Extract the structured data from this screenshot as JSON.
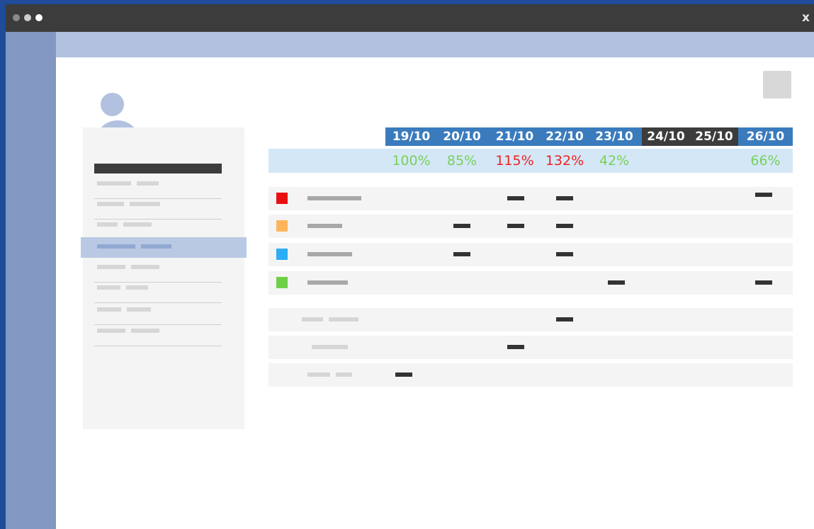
{
  "window": {
    "close_label": "x"
  },
  "colors": {
    "accent": "#3a7bbd",
    "header_dark": "#3c3c3c",
    "ok": "#77d05c",
    "over": "#ee2222",
    "sidebar_selected": "#b9c9e4"
  },
  "user": {
    "avatar_icon": "person-icon"
  },
  "calendar": {
    "days": [
      {
        "label": "19/10",
        "load": "100%",
        "status": "ok",
        "dark": false
      },
      {
        "label": "20/10",
        "load": "85%",
        "status": "ok",
        "dark": false
      },
      {
        "label": "21/10",
        "load": "115%",
        "status": "over",
        "dark": false
      },
      {
        "label": "22/10",
        "load": "132%",
        "status": "over",
        "dark": false
      },
      {
        "label": "23/10",
        "load": "42%",
        "status": "ok",
        "dark": false
      },
      {
        "label": "24/10",
        "load": "",
        "status": "",
        "dark": true
      },
      {
        "label": "25/10",
        "load": "",
        "status": "",
        "dark": true
      },
      {
        "label": "26/10",
        "load": "66%",
        "status": "ok",
        "dark": false
      }
    ],
    "color_rows": [
      {
        "color": "#e81010",
        "slots": [
          false,
          false,
          true,
          true,
          false,
          false,
          false,
          true
        ]
      },
      {
        "color": "#fdb55b",
        "slots": [
          false,
          true,
          true,
          true,
          false,
          false,
          false,
          false
        ]
      },
      {
        "color": "#2cadf5",
        "slots": [
          false,
          true,
          false,
          true,
          false,
          false,
          false,
          false
        ]
      },
      {
        "color": "#6fd047",
        "slots": [
          false,
          false,
          false,
          false,
          true,
          false,
          false,
          true
        ]
      }
    ],
    "plain_rows": [
      {
        "slots": [
          false,
          false,
          false,
          true,
          false,
          false,
          false,
          false
        ]
      },
      {
        "slots": [
          false,
          false,
          true,
          false,
          false,
          false,
          false,
          false
        ]
      },
      {
        "slots": [
          true,
          false,
          false,
          false,
          false,
          false,
          false,
          false
        ]
      }
    ]
  }
}
